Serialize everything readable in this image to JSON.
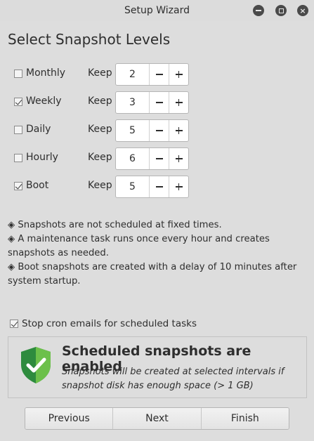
{
  "window": {
    "title": "Setup Wizard",
    "controls": {
      "minimize_icon": "minimize-icon",
      "maximize_icon": "maximize-icon",
      "close_icon": "close-icon",
      "close_glyph": "×"
    }
  },
  "page": {
    "title": "Select Snapshot Levels"
  },
  "levels": [
    {
      "name": "Monthly",
      "checked": false,
      "keep_label": "Keep",
      "value": "2"
    },
    {
      "name": "Weekly",
      "checked": true,
      "keep_label": "Keep",
      "value": "3"
    },
    {
      "name": "Daily",
      "checked": false,
      "keep_label": "Keep",
      "value": "5"
    },
    {
      "name": "Hourly",
      "checked": false,
      "keep_label": "Keep",
      "value": "6"
    },
    {
      "name": "Boot",
      "checked": true,
      "keep_label": "Keep",
      "value": "5"
    }
  ],
  "info": {
    "lines": [
      "◈ Snapshots are not scheduled at fixed times.",
      "◈ A maintenance task runs once every hour and creates snapshots as needed.",
      "◈ Boot snapshots are created with a delay of 10 minutes after system startup."
    ]
  },
  "cron": {
    "label": "Stop cron emails for scheduled tasks",
    "checked": true
  },
  "status": {
    "title": "Scheduled snapshots are enabled",
    "description": "Snapshots will be created at selected intervals if snapshot disk has enough space (> 1 GB)",
    "icon": "shield-check-icon",
    "accent": "#5cb85c"
  },
  "nav": {
    "previous": "Previous",
    "next": "Next",
    "finish": "Finish"
  }
}
